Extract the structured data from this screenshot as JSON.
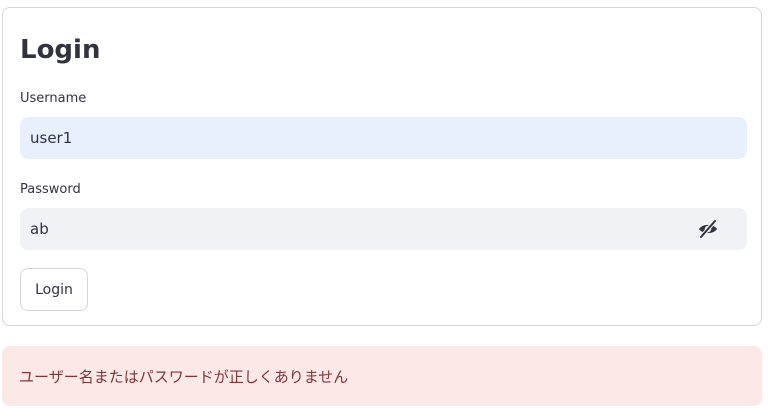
{
  "form": {
    "title": "Login",
    "username_label": "Username",
    "username_value": "user1",
    "password_label": "Password",
    "password_value": "ab",
    "password_toggle_icon": "eye-slash-icon",
    "submit_label": "Login"
  },
  "alert": {
    "message": "ユーザー名またはパスワードが正しくありません",
    "background": "#fde8e8",
    "text_color": "#7d353b"
  },
  "colors": {
    "text": "#31333f",
    "username_bg": "#e8f0fe",
    "password_bg": "#f0f2f6",
    "border": "#d6d6d9"
  }
}
